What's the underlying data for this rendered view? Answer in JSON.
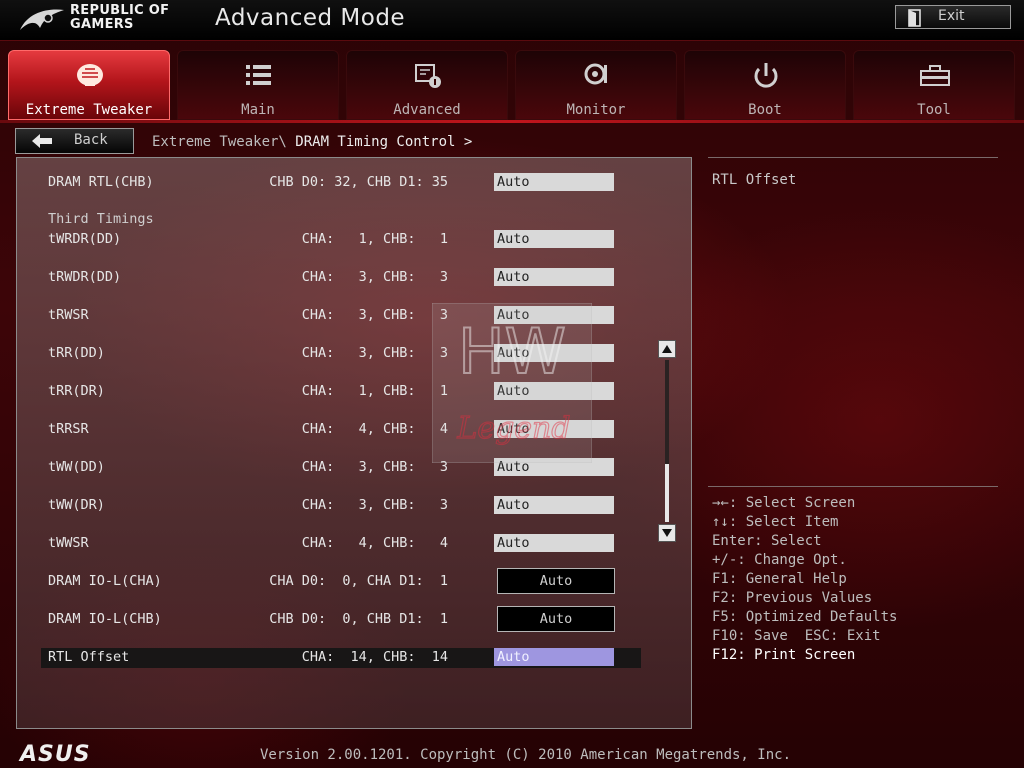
{
  "header": {
    "brand_line1": "REPUBLIC OF",
    "brand_line2": "GAMERS",
    "mode_title": "Advanced Mode",
    "exit_label": "Exit"
  },
  "tabs": [
    {
      "label": "Extreme Tweaker",
      "icon": "tweaker-icon",
      "active": true
    },
    {
      "label": "Main",
      "icon": "list-icon",
      "active": false
    },
    {
      "label": "Advanced",
      "icon": "advanced-icon",
      "active": false
    },
    {
      "label": "Monitor",
      "icon": "monitor-icon",
      "active": false
    },
    {
      "label": "Boot",
      "icon": "power-icon",
      "active": false
    },
    {
      "label": "Tool",
      "icon": "toolbox-icon",
      "active": false
    }
  ],
  "breadcrumb": {
    "back_label": "Back",
    "parent": "Extreme Tweaker\\",
    "current": " DRAM Timing Control >"
  },
  "settings": {
    "section_title": "Third Timings",
    "rows": [
      {
        "name": "DRAM RTL(CHB)",
        "value": "CHB D0: 32, CHB D1: 35",
        "option": "Auto"
      },
      {
        "name": "tWRDR(DD)",
        "value": "CHA:   1, CHB:   1",
        "option": "Auto"
      },
      {
        "name": "tRWDR(DD)",
        "value": "CHA:   3, CHB:   3",
        "option": "Auto"
      },
      {
        "name": "tRWSR",
        "value": "CHA:   3, CHB:   3",
        "option": "Auto"
      },
      {
        "name": "tRR(DD)",
        "value": "CHA:   3, CHB:   3",
        "option": "Auto"
      },
      {
        "name": "tRR(DR)",
        "value": "CHA:   1, CHB:   1",
        "option": "Auto"
      },
      {
        "name": "tRRSR",
        "value": "CHA:   4, CHB:   4",
        "option": "Auto"
      },
      {
        "name": "tWW(DD)",
        "value": "CHA:   3, CHB:   3",
        "option": "Auto"
      },
      {
        "name": "tWW(DR)",
        "value": "CHA:   3, CHB:   3",
        "option": "Auto"
      },
      {
        "name": "tWWSR",
        "value": "CHA:   4, CHB:   4",
        "option": "Auto"
      },
      {
        "name": "DRAM IO-L(CHA)",
        "value": "CHA D0:  0, CHA D1:  1",
        "option": "Auto"
      },
      {
        "name": "DRAM IO-L(CHB)",
        "value": "CHB D0:  0, CHB D1:  1",
        "option": "Auto"
      },
      {
        "name": "RTL Offset",
        "value": "CHA:  14, CHB:  14",
        "option": "Auto"
      }
    ]
  },
  "help": {
    "title": "RTL Offset",
    "keys": [
      "→←: Select Screen",
      "↑↓: Select Item",
      "Enter: Select",
      "+/-: Change Opt.",
      "F1: General Help",
      "F2: Previous Values",
      "F5: Optimized Defaults",
      "F10: Save  ESC: Exit",
      "F12: Print Screen"
    ]
  },
  "watermark": {
    "top_text": "HW",
    "script_text": "Legend"
  },
  "footer": {
    "brand": "ASUS",
    "version": "Version 2.00.1201. Copyright (C) 2010 American Megatrends, Inc."
  },
  "colors": {
    "accent_red": "#c0151c",
    "highlight_option": "#9e96e0"
  }
}
